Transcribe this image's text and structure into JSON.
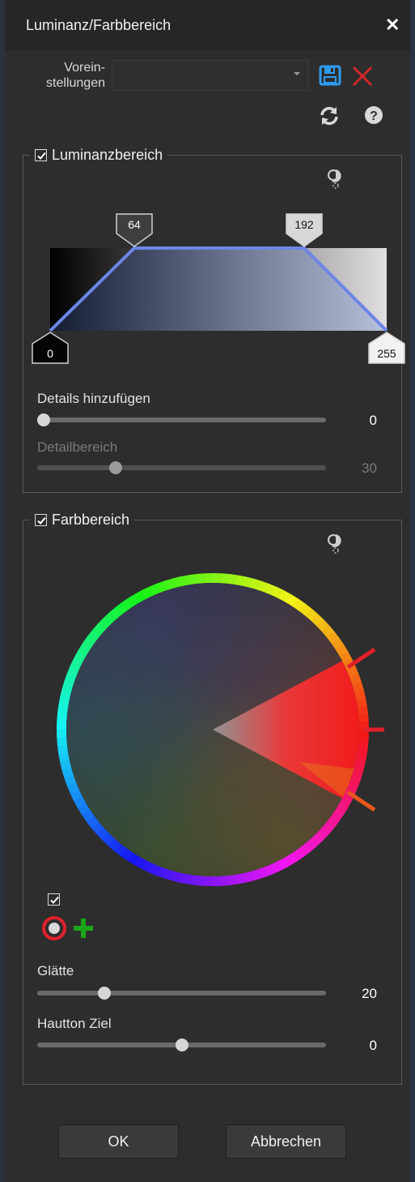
{
  "window": {
    "title": "Luminanz/Farbbereich",
    "close_glyph": "✕"
  },
  "presets": {
    "label_line1": "Vorein-",
    "label_line2": "stellungen",
    "selected": "",
    "icons": [
      "save-icon",
      "delete-icon",
      "reset-icon",
      "help-icon"
    ]
  },
  "luminance": {
    "label": "Luminanzbereich",
    "enabled": true,
    "handles": {
      "bottom_left": "0",
      "top_left": "64",
      "top_right": "192",
      "bottom_right": "255"
    },
    "details": {
      "label": "Details hinzufügen",
      "value": "0",
      "fraction": 0.0
    },
    "detail_range": {
      "label": "Detailbereich",
      "value": "30",
      "fraction": 0.26,
      "disabled": true
    }
  },
  "color": {
    "label": "Farbbereich",
    "enabled": true,
    "picker_checked": true,
    "smoothness": {
      "label": "Glätte",
      "value": "20",
      "fraction": 0.22
    },
    "skin_target": {
      "label": "Hautton Ziel",
      "value": "0",
      "fraction": 0.5
    }
  },
  "buttons": {
    "ok": "OK",
    "cancel": "Abbrechen"
  },
  "colors": {
    "accent_blue": "#6b86e8",
    "save_blue": "#2f9bf0",
    "delete_red": "#d02828",
    "add_green": "#1aa51a",
    "marker_red": "#e0202a",
    "marker_orange": "#e8561c"
  }
}
